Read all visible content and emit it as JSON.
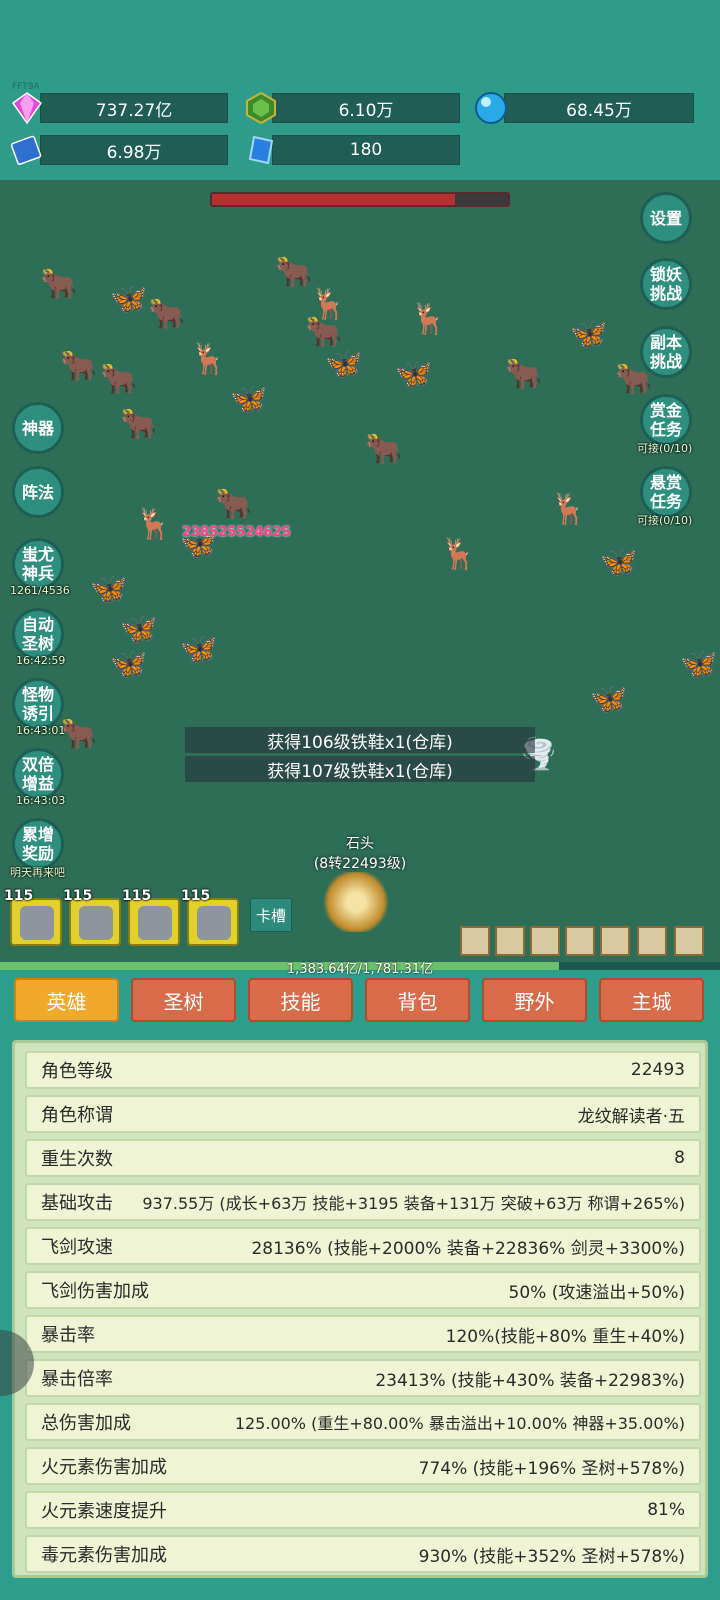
{
  "build": "FFT9A",
  "resources": [
    {
      "icon": "diamond-icon",
      "value": "737.27亿"
    },
    {
      "icon": "green-gem-icon",
      "value": "6.10万"
    },
    {
      "icon": "blue-orb-icon",
      "value": "68.45万"
    },
    {
      "icon": "book-icon",
      "value": "6.98万"
    },
    {
      "icon": "crystal-icon",
      "value": "180"
    }
  ],
  "boss_hp": 0.82,
  "right_buttons": [
    {
      "label": "设置"
    },
    {
      "label": "锁妖挑战"
    },
    {
      "label": "副本挑战"
    },
    {
      "label": "赏金任务",
      "sub": "可接(0/10)"
    },
    {
      "label": "悬赏任务",
      "sub": "可接(0/10)"
    }
  ],
  "left_buttons": [
    {
      "label": "神器"
    },
    {
      "label": "阵法"
    },
    {
      "label": "蚩尤神兵",
      "sub": "1261/4536"
    },
    {
      "label": "自动圣树",
      "sub": "16:42:59"
    },
    {
      "label": "怪物诱引",
      "sub": "16:43:01"
    },
    {
      "label": "双倍增益",
      "sub": "16:43:03"
    },
    {
      "label": "累增奖励",
      "sub": "明天再来吧"
    }
  ],
  "damage_number": "23852552462S",
  "toasts": [
    "获得106级铁鞋x1(仓库)",
    "获得107级铁鞋x1(仓库)"
  ],
  "hero": {
    "name": "石头",
    "level": "(8转22493级)"
  },
  "equipment_slots": [
    {
      "level": "115",
      "icon": "sword-icon"
    },
    {
      "level": "115",
      "icon": "helmet-icon"
    },
    {
      "level": "115",
      "icon": "armor-icon"
    },
    {
      "level": "115",
      "icon": "boots-icon"
    }
  ],
  "card_slot_label": "卡槽",
  "exp": {
    "text": "1,383.64亿/1,781.31亿",
    "fraction": 0.777
  },
  "tabs": [
    "英雄",
    "圣树",
    "技能",
    "背包",
    "野外",
    "主城"
  ],
  "active_tab": "英雄",
  "stats": [
    {
      "label": "角色等级",
      "value": "22493"
    },
    {
      "label": "角色称谓",
      "value": "龙纹解读者·五"
    },
    {
      "label": "重生次数",
      "value": "8"
    },
    {
      "label": "基础攻击",
      "value": "937.55万 (成长+63万 技能+3195 装备+131万 突破+63万 称谓+265%)"
    },
    {
      "label": "飞剑攻速",
      "value": "28136% (技能+2000% 装备+22836% 剑灵+3300%)"
    },
    {
      "label": "飞剑伤害加成",
      "value": "50% (攻速溢出+50%)"
    },
    {
      "label": "暴击率",
      "value": "120%(技能+80% 重生+40%)"
    },
    {
      "label": "暴击倍率",
      "value": "23413% (技能+430% 装备+22983%)"
    },
    {
      "label": "总伤害加成",
      "value": "125.00% (重生+80.00% 暴击溢出+10.00% 神器+35.00%)"
    },
    {
      "label": "火元素伤害加成",
      "value": "774% (技能+196% 圣树+578%)"
    },
    {
      "label": "火元素速度提升",
      "value": "81%"
    },
    {
      "label": "毒元素伤害加成",
      "value": "930% (技能+352% 圣树+578%)"
    }
  ],
  "colors": {
    "panel": "#cfe3bd",
    "tab": "#d96a4a",
    "tab_active": "#f0a92a",
    "hp": "#b53030"
  }
}
